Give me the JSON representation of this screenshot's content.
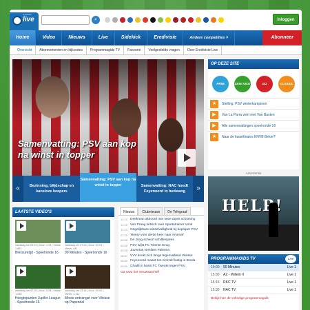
{
  "header": {
    "logo_text": "live",
    "logo_sub": "eredivisie",
    "search_placeholder": "",
    "login_label": "Inloggen",
    "club_colors": [
      "#d4d4d4",
      "#b0b0b0",
      "#c8202a",
      "#2b6cc4",
      "#e7c52a",
      "#e23a2a",
      "#151515",
      "#8ac34a",
      "#ffcf00",
      "#9a1c2a",
      "#b22222",
      "#d42027",
      "#e7c52a",
      "#1c5aa6",
      "#ec7a1e",
      "#ffd400"
    ]
  },
  "nav": {
    "items": [
      "Home",
      "Video",
      "Nieuws",
      "Live",
      "Sidekick",
      "Eredivisie"
    ],
    "more": "Andere competities",
    "subscribe": "Abonneer"
  },
  "subnav": [
    "Overzicht",
    "Abonnementen en kijkcodes",
    "Programmagids TV",
    "Fanzone",
    "Veelgestelde vragen",
    "Over Eredivisie Live"
  ],
  "hero": {
    "title": "Samenvatting: PSV aan kop na winst in topper",
    "carousel": [
      "Bezinning, blijdschap en kansloze keepers",
      "Samenvatting: PSV aan kop na winst in topper",
      "Samenvatting: NAC houdt Feyenoord in bedwang"
    ]
  },
  "side": {
    "title": "OP DEZE SITE",
    "badges": [
      {
        "label": "PRIM CODEN",
        "color": "#2ea3d8"
      },
      {
        "label": "SIDE KICK",
        "color": "#35a02b"
      },
      {
        "label": "GO",
        "color": "#d42027"
      },
      {
        "label": "CLASSIC",
        "color": "#f28c1c"
      }
    ],
    "links": [
      "Stelling: PSV winterkampioen",
      "Van La Parra viert met Van Basten",
      "Alle samenvattingen speelronde 16",
      "Naar de kwartfinales KNVB Beker?"
    ]
  },
  "ad": {
    "label": "Advertentie",
    "text": "HELP!"
  },
  "videos": {
    "title": "LAATSTE VIDEO'S",
    "items": [
      {
        "meta": "vandaag om 09:33 | Duur: 1:23 | Views: 1.861",
        "title": "Blessuretijd - Speelronde 16",
        "color": "#6c8f5a"
      },
      {
        "meta": "vandaag om 07:26 | Duur: 02:03 | Views: 441",
        "title": "90 Minutes - Speelronde 16",
        "color": "#3d7f9a"
      },
      {
        "meta": "vandaag om 07:25 | Duur: 5:25 | Views: 1.256",
        "title": "Hoogtepunten Jupiler League - Speelronde 16",
        "color": "#2f6a2c"
      },
      {
        "meta": "vandaag om 23:15 | Duur: 02:02 | Views: 1.311",
        "title": "Mooie ontvangst voor Vitesse op Papendal",
        "color": "#3a2a1a"
      }
    ]
  },
  "news": {
    "tabs": [
      "Nieuws",
      "Clubnieuws",
      "De Telegraaf"
    ],
    "items": [
      {
        "time": "14:15",
        "text": "Deekman akkoord met twee duels schorsing"
      },
      {
        "time": "12:20",
        "text": "Van Praag kritisch over Spartatrainer Vonk"
      },
      {
        "time": "10:10",
        "text": "Ongelijkbare wisselvalligheid bij koploper PSV"
      },
      {
        "time": "07:29",
        "text": "'Henry voor derde keer naar Arsenal'"
      },
      {
        "time": "06:58",
        "text": "De Jong scheurt schiltlespees"
      },
      {
        "time": "06:58",
        "text": "PSV wijst FC Twente terug"
      },
      {
        "time": "06:58",
        "text": "Juventus versliest Palermo"
      },
      {
        "time": "06:57",
        "text": "VVV knokt zich langs tegenvallend Vitesse"
      },
      {
        "time": "06:59",
        "text": "Feyenoord maakt het zichzelf lastig in Breda"
      },
      {
        "time": "06:55",
        "text": "Chadli in basis FC Twente tegen PSV"
      }
    ],
    "more": "Ga naar het nieuwsarchief"
  },
  "program": {
    "title": "PROGRAMMAGIDS TV",
    "live_badge": "Live",
    "rows": [
      {
        "time": "19:00",
        "name": "90 Minutes",
        "channel": "Live 1"
      },
      {
        "time": "15:30",
        "name": "AZ - Willem II",
        "channel": "Live 1"
      },
      {
        "time": "15:15",
        "name": "RKC TV",
        "channel": "Live 1"
      },
      {
        "time": "15:30",
        "name": "NAC TV",
        "channel": "Live 1"
      }
    ],
    "more": "Bekijk hier de volledige programmagids"
  }
}
